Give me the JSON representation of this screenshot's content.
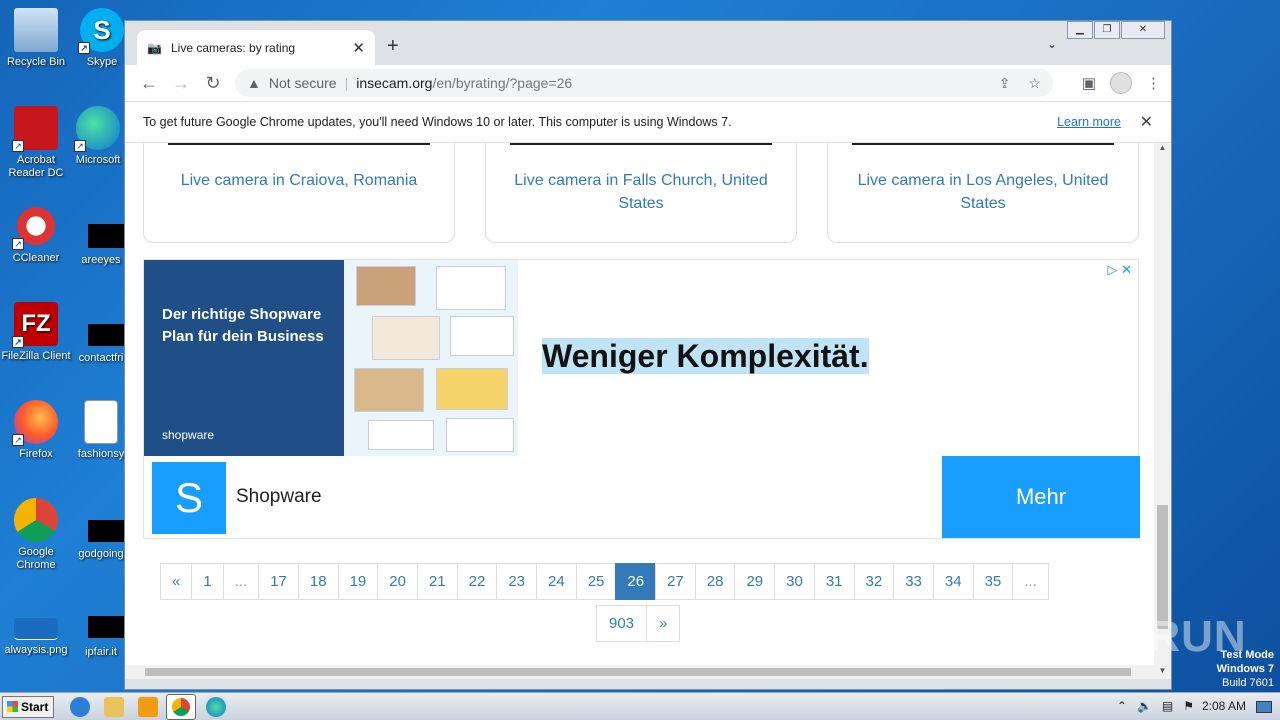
{
  "desktop": {
    "icons": [
      {
        "label": "Recycle Bin"
      },
      {
        "label": "Skype"
      },
      {
        "label": "Acrobat Reader DC"
      },
      {
        "label": "Microsoft"
      },
      {
        "label": "CCleaner"
      },
      {
        "label": "areeyes"
      },
      {
        "label": "FileZilla Client"
      },
      {
        "label": "contactfri"
      },
      {
        "label": "Firefox"
      },
      {
        "label": "fashionsy"
      },
      {
        "label": "Google Chrome"
      },
      {
        "label": "godgoing"
      },
      {
        "label": "alwaysis.png"
      },
      {
        "label": "ipfair.it"
      }
    ]
  },
  "browser": {
    "tab_title": "Live cameras: by rating",
    "address": {
      "security": "Not secure",
      "host": "insecam.org",
      "path": "/en/byrating/?page=26"
    },
    "infobar": {
      "message": "To get future Google Chrome updates, you'll need Windows 10 or later. This computer is using Windows 7.",
      "link": "Learn more"
    }
  },
  "page": {
    "cards": [
      {
        "title": "Live camera in Craiova, Romania"
      },
      {
        "title": "Live camera in Falls Church, United States"
      },
      {
        "title": "Live camera in Los Angeles, United States"
      }
    ],
    "ad": {
      "left_headline": "Der richtige Shopware Plan für dein Business",
      "left_logo": "shopware",
      "headline": "Weniger Komplexität.",
      "brand": "Shopware",
      "cta": "Mehr"
    },
    "pagination": {
      "prev": "«",
      "first": "1",
      "ellipsis": "...",
      "pages": [
        "17",
        "18",
        "19",
        "20",
        "21",
        "22",
        "23",
        "24",
        "25",
        "26",
        "27",
        "28",
        "29",
        "30",
        "31",
        "32",
        "33",
        "34",
        "35"
      ],
      "current": "26",
      "last": "903",
      "next": "»"
    }
  },
  "overlay": {
    "watermark": "ANY RUN",
    "test_mode": "Test Mode",
    "os": "Windows 7",
    "build": "Build 7601"
  },
  "taskbar": {
    "start": "Start",
    "clock": "2:08 AM"
  }
}
